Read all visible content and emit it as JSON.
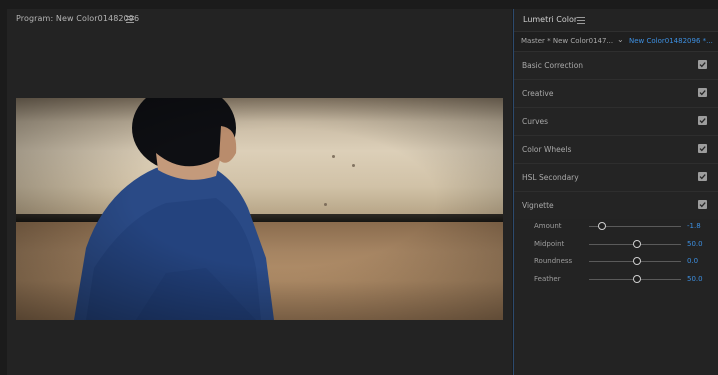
{
  "program": {
    "title": "Program: New Color01482096"
  },
  "lumetri": {
    "title": "Lumetri Color",
    "master_label": "Master * New Color0147...",
    "active_clip": "New Color01482096 *...",
    "sections": [
      {
        "label": "Basic Correction",
        "enabled": true
      },
      {
        "label": "Creative",
        "enabled": true
      },
      {
        "label": "Curves",
        "enabled": true
      },
      {
        "label": "Color Wheels",
        "enabled": true
      },
      {
        "label": "HSL Secondary",
        "enabled": true
      },
      {
        "label": "Vignette",
        "enabled": true
      }
    ],
    "vignette": [
      {
        "label": "Amount",
        "value": "-1.8",
        "level": 0.14
      },
      {
        "label": "Midpoint",
        "value": "50.0",
        "level": 0.52
      },
      {
        "label": "Roundness",
        "value": "0.0",
        "level": 0.52
      },
      {
        "label": "Feather",
        "value": "50.0",
        "level": 0.52
      }
    ]
  },
  "colors": {
    "accent": "#3d8fe0",
    "panel": "#232323",
    "background": "#1b1b1b"
  }
}
